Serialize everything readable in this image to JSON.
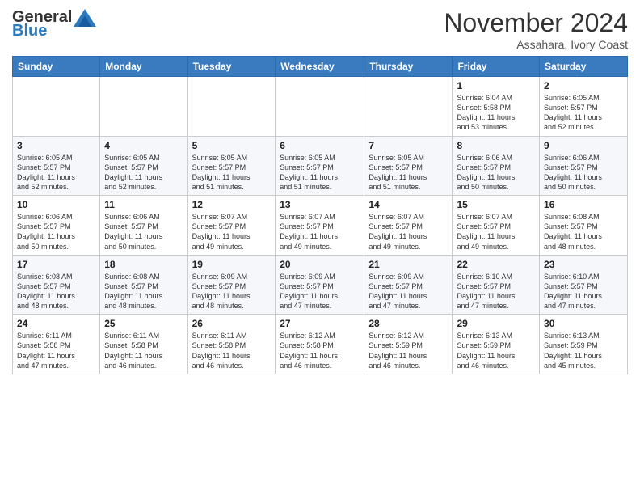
{
  "logo": {
    "general": "General",
    "blue": "Blue"
  },
  "title": "November 2024",
  "location": "Assahara, Ivory Coast",
  "days_header": [
    "Sunday",
    "Monday",
    "Tuesday",
    "Wednesday",
    "Thursday",
    "Friday",
    "Saturday"
  ],
  "weeks": [
    [
      {
        "day": "",
        "info": ""
      },
      {
        "day": "",
        "info": ""
      },
      {
        "day": "",
        "info": ""
      },
      {
        "day": "",
        "info": ""
      },
      {
        "day": "",
        "info": ""
      },
      {
        "day": "1",
        "info": "Sunrise: 6:04 AM\nSunset: 5:58 PM\nDaylight: 11 hours\nand 53 minutes."
      },
      {
        "day": "2",
        "info": "Sunrise: 6:05 AM\nSunset: 5:57 PM\nDaylight: 11 hours\nand 52 minutes."
      }
    ],
    [
      {
        "day": "3",
        "info": "Sunrise: 6:05 AM\nSunset: 5:57 PM\nDaylight: 11 hours\nand 52 minutes."
      },
      {
        "day": "4",
        "info": "Sunrise: 6:05 AM\nSunset: 5:57 PM\nDaylight: 11 hours\nand 52 minutes."
      },
      {
        "day": "5",
        "info": "Sunrise: 6:05 AM\nSunset: 5:57 PM\nDaylight: 11 hours\nand 51 minutes."
      },
      {
        "day": "6",
        "info": "Sunrise: 6:05 AM\nSunset: 5:57 PM\nDaylight: 11 hours\nand 51 minutes."
      },
      {
        "day": "7",
        "info": "Sunrise: 6:05 AM\nSunset: 5:57 PM\nDaylight: 11 hours\nand 51 minutes."
      },
      {
        "day": "8",
        "info": "Sunrise: 6:06 AM\nSunset: 5:57 PM\nDaylight: 11 hours\nand 50 minutes."
      },
      {
        "day": "9",
        "info": "Sunrise: 6:06 AM\nSunset: 5:57 PM\nDaylight: 11 hours\nand 50 minutes."
      }
    ],
    [
      {
        "day": "10",
        "info": "Sunrise: 6:06 AM\nSunset: 5:57 PM\nDaylight: 11 hours\nand 50 minutes."
      },
      {
        "day": "11",
        "info": "Sunrise: 6:06 AM\nSunset: 5:57 PM\nDaylight: 11 hours\nand 50 minutes."
      },
      {
        "day": "12",
        "info": "Sunrise: 6:07 AM\nSunset: 5:57 PM\nDaylight: 11 hours\nand 49 minutes."
      },
      {
        "day": "13",
        "info": "Sunrise: 6:07 AM\nSunset: 5:57 PM\nDaylight: 11 hours\nand 49 minutes."
      },
      {
        "day": "14",
        "info": "Sunrise: 6:07 AM\nSunset: 5:57 PM\nDaylight: 11 hours\nand 49 minutes."
      },
      {
        "day": "15",
        "info": "Sunrise: 6:07 AM\nSunset: 5:57 PM\nDaylight: 11 hours\nand 49 minutes."
      },
      {
        "day": "16",
        "info": "Sunrise: 6:08 AM\nSunset: 5:57 PM\nDaylight: 11 hours\nand 48 minutes."
      }
    ],
    [
      {
        "day": "17",
        "info": "Sunrise: 6:08 AM\nSunset: 5:57 PM\nDaylight: 11 hours\nand 48 minutes."
      },
      {
        "day": "18",
        "info": "Sunrise: 6:08 AM\nSunset: 5:57 PM\nDaylight: 11 hours\nand 48 minutes."
      },
      {
        "day": "19",
        "info": "Sunrise: 6:09 AM\nSunset: 5:57 PM\nDaylight: 11 hours\nand 48 minutes."
      },
      {
        "day": "20",
        "info": "Sunrise: 6:09 AM\nSunset: 5:57 PM\nDaylight: 11 hours\nand 47 minutes."
      },
      {
        "day": "21",
        "info": "Sunrise: 6:09 AM\nSunset: 5:57 PM\nDaylight: 11 hours\nand 47 minutes."
      },
      {
        "day": "22",
        "info": "Sunrise: 6:10 AM\nSunset: 5:57 PM\nDaylight: 11 hours\nand 47 minutes."
      },
      {
        "day": "23",
        "info": "Sunrise: 6:10 AM\nSunset: 5:57 PM\nDaylight: 11 hours\nand 47 minutes."
      }
    ],
    [
      {
        "day": "24",
        "info": "Sunrise: 6:11 AM\nSunset: 5:58 PM\nDaylight: 11 hours\nand 47 minutes."
      },
      {
        "day": "25",
        "info": "Sunrise: 6:11 AM\nSunset: 5:58 PM\nDaylight: 11 hours\nand 46 minutes."
      },
      {
        "day": "26",
        "info": "Sunrise: 6:11 AM\nSunset: 5:58 PM\nDaylight: 11 hours\nand 46 minutes."
      },
      {
        "day": "27",
        "info": "Sunrise: 6:12 AM\nSunset: 5:58 PM\nDaylight: 11 hours\nand 46 minutes."
      },
      {
        "day": "28",
        "info": "Sunrise: 6:12 AM\nSunset: 5:59 PM\nDaylight: 11 hours\nand 46 minutes."
      },
      {
        "day": "29",
        "info": "Sunrise: 6:13 AM\nSunset: 5:59 PM\nDaylight: 11 hours\nand 46 minutes."
      },
      {
        "day": "30",
        "info": "Sunrise: 6:13 AM\nSunset: 5:59 PM\nDaylight: 11 hours\nand 45 minutes."
      }
    ]
  ]
}
